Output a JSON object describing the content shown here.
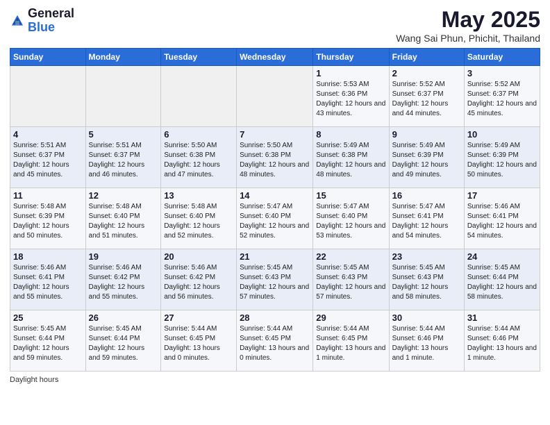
{
  "header": {
    "logo_general": "General",
    "logo_blue": "Blue",
    "month_title": "May 2025",
    "subtitle": "Wang Sai Phun, Phichit, Thailand"
  },
  "days_of_week": [
    "Sunday",
    "Monday",
    "Tuesday",
    "Wednesday",
    "Thursday",
    "Friday",
    "Saturday"
  ],
  "weeks": [
    [
      {
        "day": "",
        "info": ""
      },
      {
        "day": "",
        "info": ""
      },
      {
        "day": "",
        "info": ""
      },
      {
        "day": "",
        "info": ""
      },
      {
        "day": "1",
        "info": "Sunrise: 5:53 AM\nSunset: 6:36 PM\nDaylight: 12 hours and 43 minutes."
      },
      {
        "day": "2",
        "info": "Sunrise: 5:52 AM\nSunset: 6:37 PM\nDaylight: 12 hours and 44 minutes."
      },
      {
        "day": "3",
        "info": "Sunrise: 5:52 AM\nSunset: 6:37 PM\nDaylight: 12 hours and 45 minutes."
      }
    ],
    [
      {
        "day": "4",
        "info": "Sunrise: 5:51 AM\nSunset: 6:37 PM\nDaylight: 12 hours and 45 minutes."
      },
      {
        "day": "5",
        "info": "Sunrise: 5:51 AM\nSunset: 6:37 PM\nDaylight: 12 hours and 46 minutes."
      },
      {
        "day": "6",
        "info": "Sunrise: 5:50 AM\nSunset: 6:38 PM\nDaylight: 12 hours and 47 minutes."
      },
      {
        "day": "7",
        "info": "Sunrise: 5:50 AM\nSunset: 6:38 PM\nDaylight: 12 hours and 48 minutes."
      },
      {
        "day": "8",
        "info": "Sunrise: 5:49 AM\nSunset: 6:38 PM\nDaylight: 12 hours and 48 minutes."
      },
      {
        "day": "9",
        "info": "Sunrise: 5:49 AM\nSunset: 6:39 PM\nDaylight: 12 hours and 49 minutes."
      },
      {
        "day": "10",
        "info": "Sunrise: 5:49 AM\nSunset: 6:39 PM\nDaylight: 12 hours and 50 minutes."
      }
    ],
    [
      {
        "day": "11",
        "info": "Sunrise: 5:48 AM\nSunset: 6:39 PM\nDaylight: 12 hours and 50 minutes."
      },
      {
        "day": "12",
        "info": "Sunrise: 5:48 AM\nSunset: 6:40 PM\nDaylight: 12 hours and 51 minutes."
      },
      {
        "day": "13",
        "info": "Sunrise: 5:48 AM\nSunset: 6:40 PM\nDaylight: 12 hours and 52 minutes."
      },
      {
        "day": "14",
        "info": "Sunrise: 5:47 AM\nSunset: 6:40 PM\nDaylight: 12 hours and 52 minutes."
      },
      {
        "day": "15",
        "info": "Sunrise: 5:47 AM\nSunset: 6:40 PM\nDaylight: 12 hours and 53 minutes."
      },
      {
        "day": "16",
        "info": "Sunrise: 5:47 AM\nSunset: 6:41 PM\nDaylight: 12 hours and 54 minutes."
      },
      {
        "day": "17",
        "info": "Sunrise: 5:46 AM\nSunset: 6:41 PM\nDaylight: 12 hours and 54 minutes."
      }
    ],
    [
      {
        "day": "18",
        "info": "Sunrise: 5:46 AM\nSunset: 6:41 PM\nDaylight: 12 hours and 55 minutes."
      },
      {
        "day": "19",
        "info": "Sunrise: 5:46 AM\nSunset: 6:42 PM\nDaylight: 12 hours and 55 minutes."
      },
      {
        "day": "20",
        "info": "Sunrise: 5:46 AM\nSunset: 6:42 PM\nDaylight: 12 hours and 56 minutes."
      },
      {
        "day": "21",
        "info": "Sunrise: 5:45 AM\nSunset: 6:43 PM\nDaylight: 12 hours and 57 minutes."
      },
      {
        "day": "22",
        "info": "Sunrise: 5:45 AM\nSunset: 6:43 PM\nDaylight: 12 hours and 57 minutes."
      },
      {
        "day": "23",
        "info": "Sunrise: 5:45 AM\nSunset: 6:43 PM\nDaylight: 12 hours and 58 minutes."
      },
      {
        "day": "24",
        "info": "Sunrise: 5:45 AM\nSunset: 6:44 PM\nDaylight: 12 hours and 58 minutes."
      }
    ],
    [
      {
        "day": "25",
        "info": "Sunrise: 5:45 AM\nSunset: 6:44 PM\nDaylight: 12 hours and 59 minutes."
      },
      {
        "day": "26",
        "info": "Sunrise: 5:45 AM\nSunset: 6:44 PM\nDaylight: 12 hours and 59 minutes."
      },
      {
        "day": "27",
        "info": "Sunrise: 5:44 AM\nSunset: 6:45 PM\nDaylight: 13 hours and 0 minutes."
      },
      {
        "day": "28",
        "info": "Sunrise: 5:44 AM\nSunset: 6:45 PM\nDaylight: 13 hours and 0 minutes."
      },
      {
        "day": "29",
        "info": "Sunrise: 5:44 AM\nSunset: 6:45 PM\nDaylight: 13 hours and 1 minute."
      },
      {
        "day": "30",
        "info": "Sunrise: 5:44 AM\nSunset: 6:46 PM\nDaylight: 13 hours and 1 minute."
      },
      {
        "day": "31",
        "info": "Sunrise: 5:44 AM\nSunset: 6:46 PM\nDaylight: 13 hours and 1 minute."
      }
    ]
  ],
  "footer": {
    "text": "Daylight hours"
  }
}
